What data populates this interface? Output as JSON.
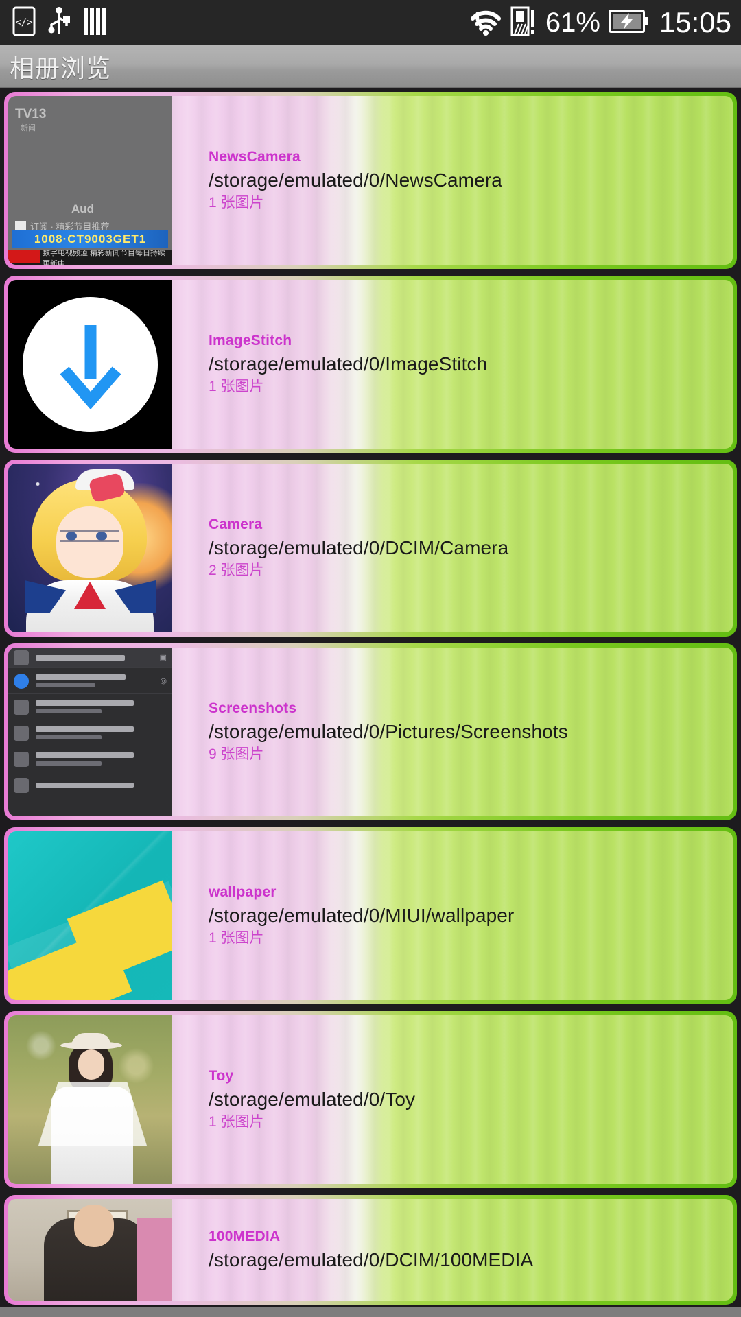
{
  "statusbar": {
    "icons_left": [
      "code-badge-icon",
      "usb-icon",
      "bars-icon"
    ],
    "icons_right": [
      "wifi-icon",
      "signal-icon",
      "battery-charging-icon"
    ],
    "battery_percent": "61%",
    "time": "15:05"
  },
  "actionbar": {
    "title": "相册浏览"
  },
  "albums": [
    {
      "name": "NewsCamera",
      "path": "/storage/emulated/0/NewsCamera",
      "count": "1 张图片",
      "thumb": "news-camera-thumbnail",
      "thumb_texts": {
        "tv": "TV13",
        "sub": "新闻",
        "aud": "Aud",
        "line1": "订阅 · 精彩节目推荐",
        "bar": "1008·CT9003GET1",
        "foot": "数字电视频道 精彩新闻节目每日持续更新中…"
      }
    },
    {
      "name": "ImageStitch",
      "path": "/storage/emulated/0/ImageStitch",
      "count": "1 张图片",
      "thumb": "image-stitch-thumbnail"
    },
    {
      "name": "Camera",
      "path": "/storage/emulated/0/DCIM/Camera",
      "count": "2 张图片",
      "thumb": "camera-anime-thumbnail"
    },
    {
      "name": "Screenshots",
      "path": "/storage/emulated/0/Pictures/Screenshots",
      "count": "9 张图片",
      "thumb": "screenshots-thumbnail"
    },
    {
      "name": "wallpaper",
      "path": "/storage/emulated/0/MIUI/wallpaper",
      "count": "1 张图片",
      "thumb": "wallpaper-geometric-thumbnail"
    },
    {
      "name": "Toy",
      "path": "/storage/emulated/0/Toy",
      "count": "1 张图片",
      "thumb": "toy-portrait-thumbnail"
    },
    {
      "name": "100MEDIA",
      "path": "/storage/emulated/0/DCIM/100MEDIA",
      "count": "",
      "thumb": "media-photo-thumbnail"
    }
  ],
  "colors": {
    "album_name": "#cc33cc",
    "album_path": "#1a1a1a",
    "album_count": "#cc44cc",
    "border_left": "#e87ad4",
    "border_right": "#63bd12",
    "statusbar_bg": "#262626",
    "actionbar_text": "#f2f2f2"
  }
}
